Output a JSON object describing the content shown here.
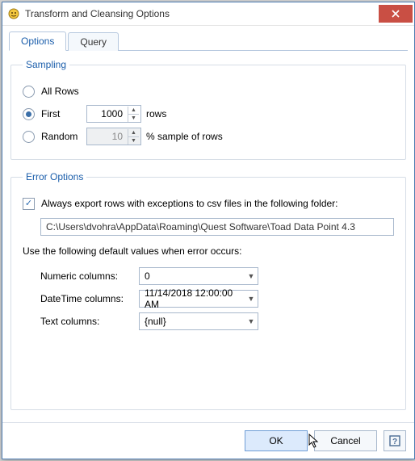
{
  "window": {
    "title": "Transform and Cleansing Options"
  },
  "tabs": {
    "options": "Options",
    "query": "Query"
  },
  "sampling": {
    "legend": "Sampling",
    "all_rows": "All Rows",
    "first": "First",
    "first_value": "1000",
    "first_unit": "rows",
    "random": "Random",
    "random_value": "10",
    "random_unit": "% sample of rows",
    "selected": "first"
  },
  "error": {
    "legend": "Error Options",
    "export_label": "Always export rows with exceptions to csv files in the following folder:",
    "export_checked": true,
    "folder": "C:\\Users\\dvohra\\AppData\\Roaming\\Quest Software\\Toad Data Point 4.3",
    "defaults_intro": "Use the following default values when error occurs:",
    "numeric_label": "Numeric columns:",
    "numeric_value": "0",
    "datetime_label": "DateTime columns:",
    "datetime_value": "11/14/2018 12:00:00 AM",
    "text_label": "Text columns:",
    "text_value": "{null}"
  },
  "footer": {
    "ok": "OK",
    "cancel": "Cancel"
  }
}
